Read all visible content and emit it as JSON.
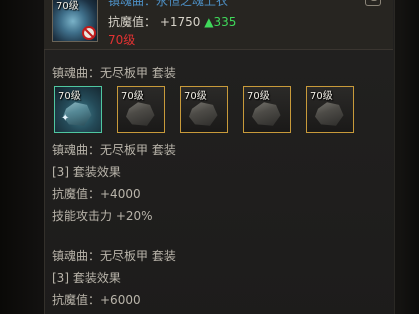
{
  "item": {
    "icon_level": "70级",
    "name": "镇魂曲：永恒之魂上衣",
    "resist_label": "抗魔值：",
    "resist_value": "+1750",
    "resist_upgrade": "▲335",
    "level_requirement": "70级"
  },
  "set_section_title": "镇魂曲：无尽板甲  套装",
  "slots": [
    {
      "level": "70级",
      "state": "active"
    },
    {
      "level": "70级",
      "state": "inactive"
    },
    {
      "level": "70级",
      "state": "inactive"
    },
    {
      "level": "70级",
      "state": "inactive"
    },
    {
      "level": "70级",
      "state": "inactive"
    }
  ],
  "set_bonuses": [
    {
      "set_name": "镇魂曲：无尽板甲  套装",
      "tier": "[3] 套装效果",
      "lines": [
        "抗魔值：+4000",
        "技能攻击力 +20%"
      ]
    },
    {
      "set_name": "镇魂曲：无尽板甲  套装",
      "tier": "[3] 套装效果",
      "lines": [
        "抗魔值：+6000"
      ]
    }
  ],
  "colors": {
    "item_name": "#4d8fc4",
    "upgrade": "#3fd85a",
    "level_requirement": "#e23232",
    "slot_border": "#c89a3a",
    "slot_active_border": "#4fc7a0"
  }
}
